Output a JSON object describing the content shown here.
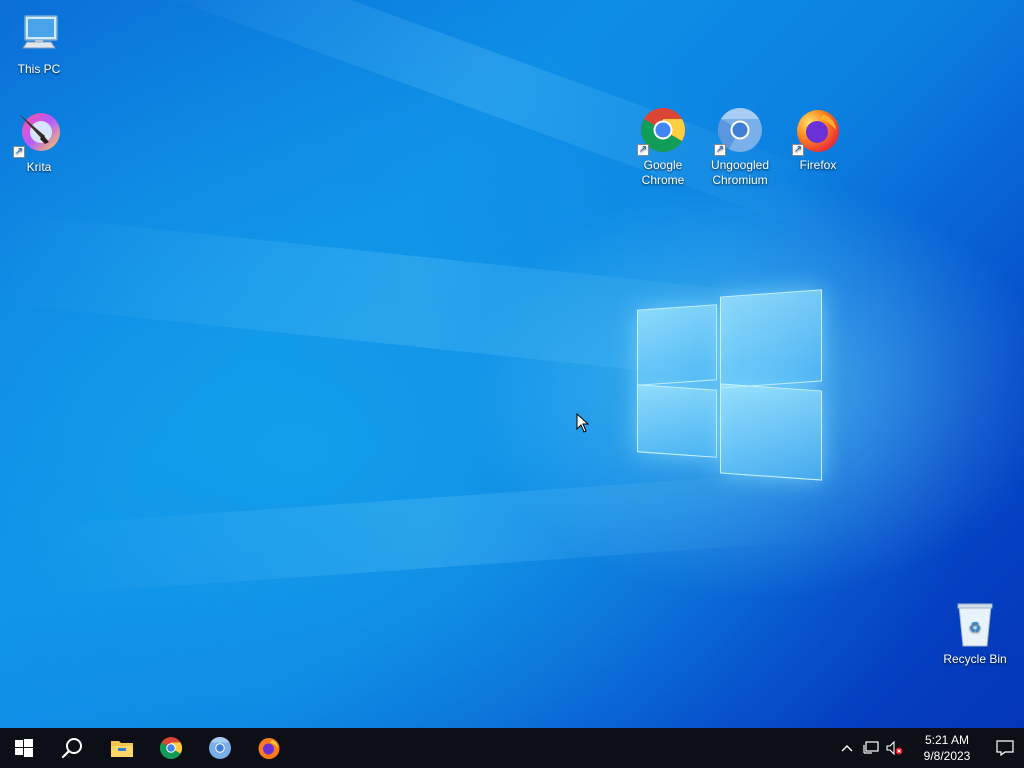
{
  "desktop": {
    "icons": [
      {
        "label": "This PC",
        "icon": "computer-icon"
      },
      {
        "label": "Krita",
        "icon": "krita-icon"
      },
      {
        "label": "Google\nChrome",
        "icon": "chrome-icon"
      },
      {
        "label": "Ungoogled\nChromium",
        "icon": "chromium-icon"
      },
      {
        "label": "Firefox",
        "icon": "firefox-icon"
      },
      {
        "label": "Recycle Bin",
        "icon": "recycle-bin-icon"
      }
    ]
  },
  "taskbar": {
    "buttons": [
      {
        "name": "start",
        "icon": "windows-start-icon"
      },
      {
        "name": "search",
        "icon": "search-icon"
      },
      {
        "name": "file-explorer",
        "icon": "folder-icon"
      },
      {
        "name": "google-chrome",
        "icon": "chrome-icon"
      },
      {
        "name": "ungoogled-chromium",
        "icon": "chromium-icon"
      },
      {
        "name": "firefox",
        "icon": "firefox-icon"
      }
    ],
    "tray": {
      "time": "5:21 AM",
      "date": "9/8/2023",
      "icons": [
        "chevron-up-icon",
        "network-icon",
        "volume-muted-icon",
        "notification-icon"
      ]
    }
  },
  "colors": {
    "taskbar": "#0c1016",
    "desktop_accent": "#0b7fe0"
  }
}
